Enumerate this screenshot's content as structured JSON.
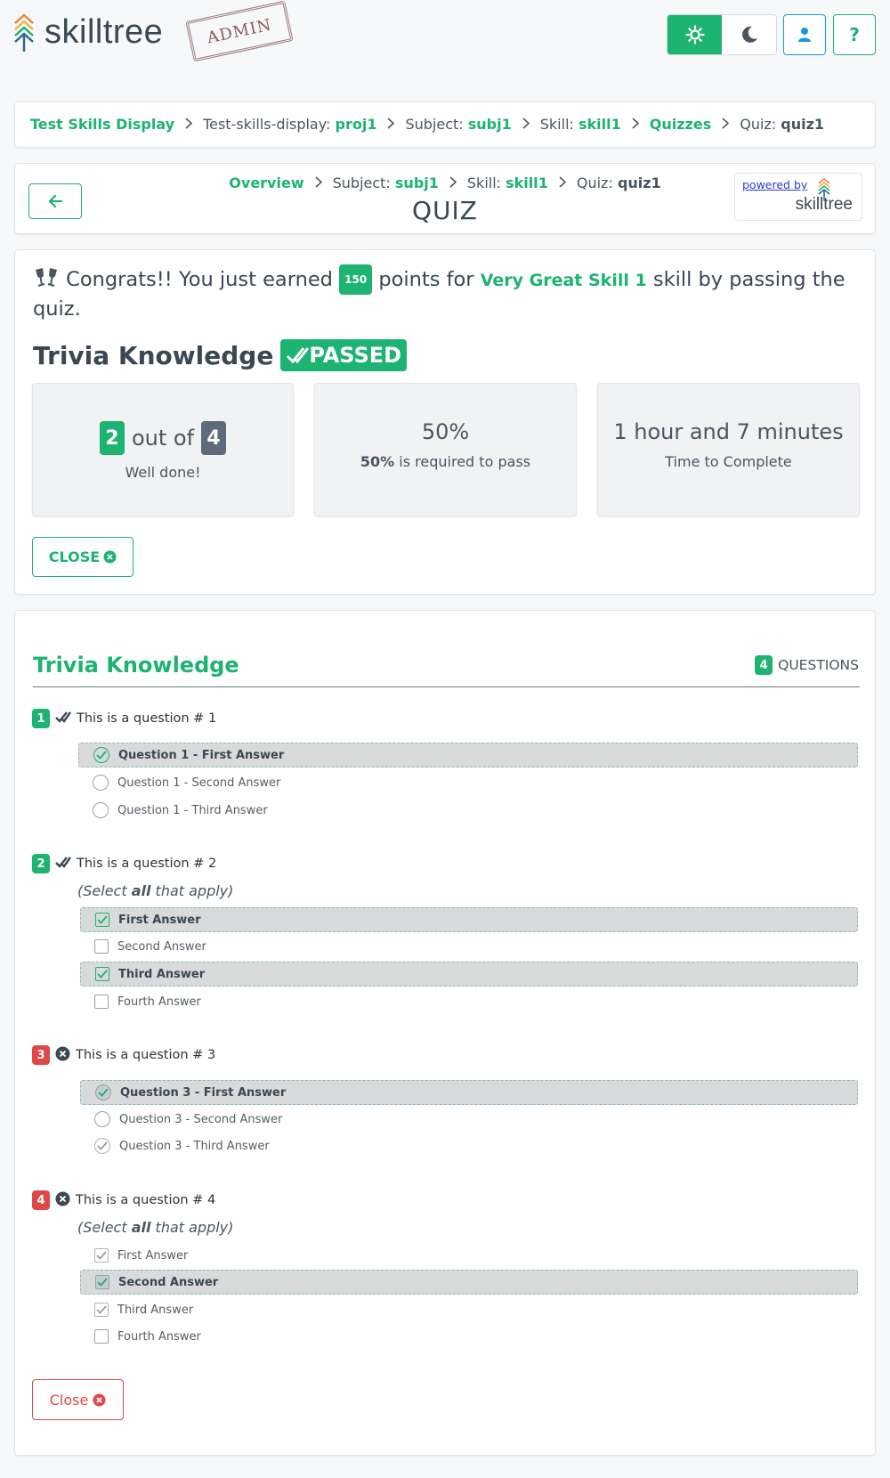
{
  "header": {
    "logo_text": "skilltree",
    "admin_stamp": "ADMIN"
  },
  "breadcrumb": [
    {
      "prefix": "",
      "value": "Test Skills Display",
      "link": true
    },
    {
      "prefix": "Test-skills-display: ",
      "value": "proj1",
      "link": false
    },
    {
      "prefix": "Subject: ",
      "value": "subj1",
      "link": false
    },
    {
      "prefix": "Skill: ",
      "value": "skill1",
      "link": false
    },
    {
      "prefix": "",
      "value": "Quizzes",
      "link": true
    },
    {
      "prefix": "Quiz: ",
      "value": "quiz1",
      "link": false
    }
  ],
  "quiz_header": {
    "crumbs": [
      {
        "prefix": "",
        "value": "Overview",
        "link": true
      },
      {
        "prefix": "Subject: ",
        "value": "subj1",
        "link": false
      },
      {
        "prefix": "Skill: ",
        "value": "skill1",
        "link": false
      },
      {
        "prefix": "Quiz: ",
        "value": "quiz1",
        "link": false
      }
    ],
    "title": "QUIZ",
    "powered_by": "powered by",
    "powered_logo": "skilltree"
  },
  "result": {
    "congrats_pre": "Congrats!! You just earned",
    "points": "150",
    "congrats_mid": "points for",
    "skill_name": "Very Great Skill 1",
    "congrats_post": "skill by passing the quiz.",
    "quiz_name": "Trivia Knowledge",
    "passed_label": "PASSED",
    "score_correct": "2",
    "score_out_of": "out of",
    "score_total": "4",
    "score_msg": "Well done!",
    "percent": "50%",
    "percent_required": "50%",
    "percent_required_text": "is required to pass",
    "time": "1 hour and 7 minutes",
    "time_label": "Time to Complete",
    "close_label": "CLOSE"
  },
  "questions_card": {
    "title": "Trivia Knowledge",
    "count": "4",
    "count_label": "QUESTIONS",
    "select_all_pre": "(Select ",
    "select_all_bold": "all",
    "select_all_post": " that apply)",
    "close_label": "Close"
  },
  "questions": [
    {
      "num": "1",
      "text": "This is a question # 1",
      "correct": true,
      "answers": [
        "Question 1 - First Answer",
        "Question 1 - Second Answer",
        "Question 1 - Third Answer"
      ]
    },
    {
      "num": "2",
      "text": "This is a question # 2",
      "correct": true,
      "answers": [
        "First Answer",
        "Second Answer",
        "Third Answer",
        "Fourth Answer"
      ]
    },
    {
      "num": "3",
      "text": "This is a question # 3",
      "correct": false,
      "answers": [
        "Question 3 - First Answer",
        "Question 3 - Second Answer",
        "Question 3 - Third Answer"
      ]
    },
    {
      "num": "4",
      "text": "This is a question # 4",
      "correct": false,
      "answers": [
        "First Answer",
        "Second Answer",
        "Third Answer",
        "Fourth Answer"
      ]
    }
  ],
  "icons": {
    "sun": "sun-icon",
    "moon": "moon-icon",
    "user": "user-icon",
    "help": "help-icon",
    "back": "arrow-left-icon",
    "glasses": "champagne-glasses-icon",
    "passed": "double-check-icon",
    "close": "close-circle-icon"
  },
  "colors": {
    "accent": "#1db371",
    "danger": "#e04848",
    "info": "#1a9ad6",
    "neutral": "#5f6b78"
  }
}
